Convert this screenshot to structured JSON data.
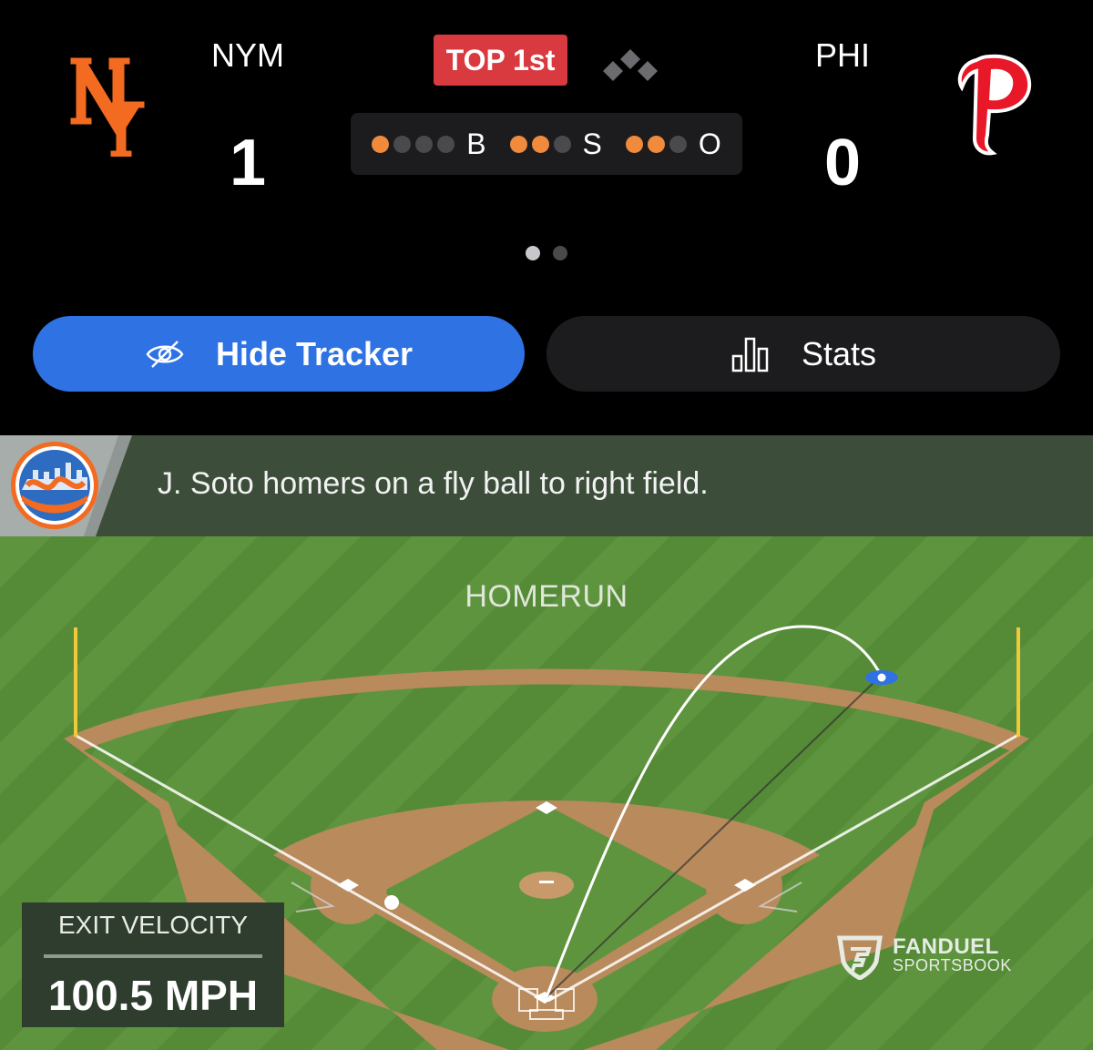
{
  "scoreboard": {
    "away": {
      "abbr": "NYM",
      "score": "1",
      "logo": "mets-logo",
      "color": "#f26b21"
    },
    "home": {
      "abbr": "PHI",
      "score": "0",
      "logo": "phillies-logo",
      "color": "#e81828"
    },
    "inning": "TOP 1st",
    "bases_icon": "bases-diamond-icon",
    "count": {
      "balls": {
        "label": "B",
        "on": 1,
        "total": 4
      },
      "strikes": {
        "label": "S",
        "on": 2,
        "total": 3
      },
      "outs": {
        "label": "O",
        "on": 2,
        "total": 3
      }
    },
    "pager": {
      "current": 1,
      "total": 2
    }
  },
  "actions": {
    "hide_tracker": {
      "label": "Hide Tracker",
      "icon": "eye-slash-icon"
    },
    "stats": {
      "label": "Stats",
      "icon": "bar-chart-icon"
    }
  },
  "play": {
    "team_logo": "mets-logo",
    "description": "J. Soto homers on a fly ball to right field."
  },
  "tracker": {
    "result": "HOMERUN",
    "exit_velocity": {
      "label": "EXIT VELOCITY",
      "value": "100.5 MPH"
    },
    "sponsor": {
      "name": "FANDUEL",
      "sub": "SPORTSBOOK",
      "icon": "fanduel-shield-icon"
    }
  },
  "colors": {
    "accent_blue": "#2f72e4",
    "badge_red": "#d93a3f",
    "count_on": "#f08a3c",
    "field_green": "#5f943f"
  }
}
